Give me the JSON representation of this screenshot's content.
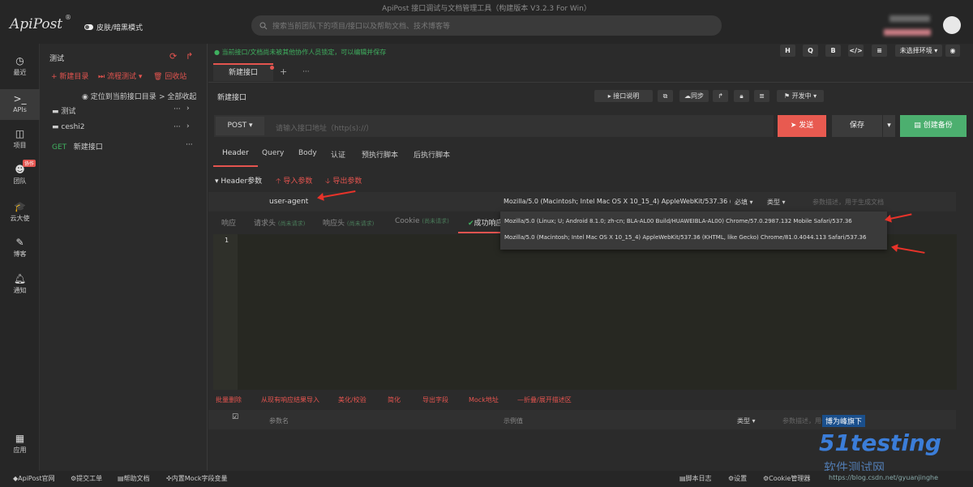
{
  "window_title": "ApiPost 接口调试与文档管理工具（构建版本 V3.2.3 For Win）",
  "logo": "ApiPost",
  "logo_mark": "®",
  "theme_toggle": "皮肤/暗黑模式",
  "search_placeholder": "搜索当前团队下的项目/接口以及帮助文档、技术博客等",
  "nav": [
    {
      "label": "最近",
      "icon": "clock-icon"
    },
    {
      "label": "APIs",
      "icon": "terminal-icon"
    },
    {
      "label": "项目",
      "icon": "grid-icon"
    },
    {
      "label": "团队",
      "icon": "team-icon",
      "badge": "协作"
    },
    {
      "label": "云大使",
      "icon": "hat-icon"
    },
    {
      "label": "博客",
      "icon": "edit-icon"
    },
    {
      "label": "通知",
      "icon": "bell-icon"
    },
    {
      "label": "应用",
      "icon": "apps-icon"
    }
  ],
  "project": {
    "name": "测试",
    "new_dir": "+ 新建目录",
    "flow_test": "⏭ 流程测试 ▾",
    "recycle": "🗑 回收站",
    "locate": "定位到当前接口目录",
    "collapse": "> 全部收起",
    "tree": [
      {
        "type": "folder",
        "label": "测试"
      },
      {
        "type": "folder",
        "label": "ceshi2"
      },
      {
        "type": "api",
        "method": "GET",
        "label": "新建接口"
      }
    ]
  },
  "notice": "当前接口/文档尚未被其他协作人员锁定，可以编辑并保存",
  "toolbar": {
    "icons": [
      "H",
      "Q",
      "B",
      "</>",
      "≡"
    ],
    "env": "未选择环境 ▾"
  },
  "tabs": {
    "active": "新建接口",
    "add": "+",
    "more": "···"
  },
  "api": {
    "name": "新建接口",
    "doc": "▸ 接口说明",
    "sync": "同步",
    "status": "开发中 ▾",
    "method": "POST ▾",
    "url_placeholder": "请输入接口地址（http(s)://）",
    "send": "发送",
    "save": "保存",
    "create_backup": "创建备份"
  },
  "req_tabs": [
    "Header",
    "Query",
    "Body",
    "认证",
    "预执行脚本",
    "后执行脚本"
  ],
  "header_section": {
    "title": "▾ Header参数",
    "import": "🡡 导入参数",
    "export": "🡣 导出参数",
    "row": {
      "key": "user-agent",
      "value": "Mozilla/5.0 (Macintosh; Intel Mac OS X 10_15_4) AppleWebKit/537.36 (KHT",
      "required": "必填 ▾",
      "type": "类型 ▾",
      "desc_placeholder": "参数描述，用于生成文档"
    }
  },
  "suggestions": [
    "Mozilla/5.0 (Linux; U; Android 8.1.0; zh-cn; BLA-AL00 Build/HUAWEIBLA-AL00) Chrome/57.0.2987.132 Mobile Safari/537.36",
    "Mozilla/5.0 (Macintosh; Intel Mac OS X 10_15_4) AppleWebKit/537.36 (KHTML, like Gecko) Chrome/81.0.4044.113 Safari/537.36"
  ],
  "resp_tabs": [
    {
      "label": "响应",
      "note": ""
    },
    {
      "label": "请求头",
      "note": "(尚未请求)"
    },
    {
      "label": "响应头",
      "note": "(尚未请求)"
    },
    {
      "label": "Cookie",
      "note": "(尚未请求)"
    },
    {
      "label": "成功响应",
      "note": ""
    }
  ],
  "editor": {
    "line": "1"
  },
  "bottom_tools": [
    "批量删除",
    "从现有响应结果导入",
    "美化/校验",
    "简化",
    "导出字段",
    "Mock地址",
    "—折叠/展开描述区"
  ],
  "param_table": {
    "check": "☑",
    "name": "参数名",
    "example": "示例值",
    "type": "类型 ▾",
    "desc": "参数描述，用于生成文档"
  },
  "footer_left": [
    "◆ApiPost官网",
    "⚙提交工单",
    "▤帮助文档",
    "✣内置Mock字段变量"
  ],
  "footer_right": [
    "▤脚本日志",
    "⚙设置",
    "⚙Cookie管理器",
    "https://blog.csdn.net/gyuanjinghe"
  ],
  "watermark": {
    "top": "博为峰旗下",
    "brand": "51testing",
    "sub": "软件测试网"
  },
  "colors": {
    "accent_red": "#e4544f",
    "send": "#e85a50",
    "backup": "#4caf6f",
    "notice": "#3fb05f"
  }
}
